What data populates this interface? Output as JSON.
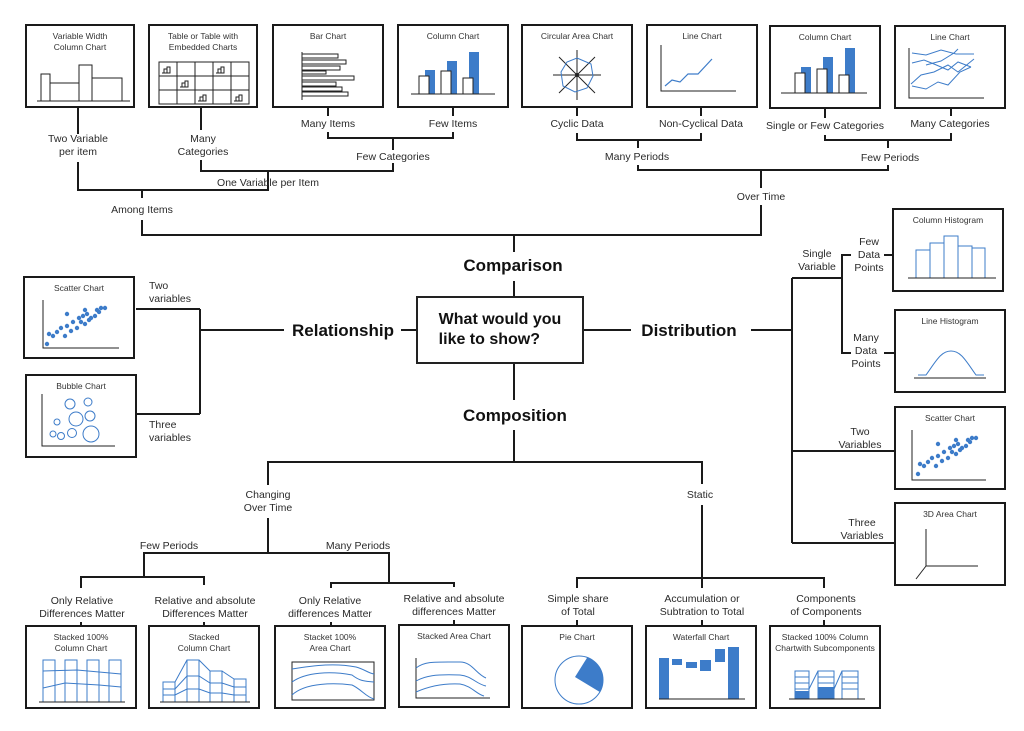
{
  "central_question": "What would you\nlike to show?",
  "categories": {
    "comparison": "Comparison",
    "relationship": "Relationship",
    "distribution": "Distribution",
    "composition": "Composition"
  },
  "accent_color": "#3d7cc9",
  "comparison": {
    "among_items": "Among Items",
    "over_time": "Over Time",
    "two_variable_per_item": "Two Variable\nper item",
    "one_variable_per_item": "One Variable per Item",
    "many_categories": "Many\nCategories",
    "few_categories": "Few Categories",
    "many_items": "Many Items",
    "few_items": "Few Items",
    "many_periods": "Many Periods",
    "few_periods": "Few Periods",
    "cyclic_data": "Cyclic Data",
    "non_cyclical_data": "Non-Cyclical Data",
    "single_or_few_categories": "Single or Few Categories",
    "many_categories_time": "Many Categories",
    "charts": {
      "variable_width": "Variable Width\nColumn Chart",
      "table_embedded": "Table or Table with\nEmbedded Charts",
      "bar_chart": "Bar Chart",
      "column_chart_items": "Column Chart",
      "circular_area": "Circular Area Chart",
      "line_chart_noncyclic": "Line Chart",
      "column_chart_time": "Column Chart",
      "line_chart_many": "Line Chart"
    }
  },
  "relationship": {
    "two_variables": "Two\nvariables",
    "three_variables": "Three\nvariables",
    "charts": {
      "scatter": "Scatter Chart",
      "bubble": "Bubble Chart"
    }
  },
  "distribution": {
    "single_variable": "Single\nVariable",
    "few_data_points": "Few\nData\nPoints",
    "many_data_points": "Many\nData\nPoints",
    "two_variables": "Two\nVariables",
    "three_variables": "Three\nVariables",
    "charts": {
      "column_histogram": "Column Histogram",
      "line_histogram": "Line Histogram",
      "scatter": "Scatter Chart",
      "area_3d": "3D Area Chart"
    }
  },
  "composition": {
    "changing_over_time": "Changing\nOver Time",
    "static": "Static",
    "few_periods": "Few Periods",
    "many_periods": "Many Periods",
    "only_relative_few": "Only Relative\nDifferences Matter",
    "relative_absolute_few": "Relative and absolute\nDifferences Matter",
    "only_relative_many": "Only Relative\ndifferences Matter",
    "relative_absolute_many": "Relative and absolute\ndifferences Matter",
    "simple_share": "Simple share\nof Total",
    "accumulation": "Accumulation or\nSubtration to Total",
    "components": "Components\nof Components",
    "charts": {
      "stacked_100_column": "Stacked 100%\nColumn Chart",
      "stacked_column": "Stacked\nColumn Chart",
      "stacked_100_area": "Stacket 100%\nArea Chart",
      "stacked_area": "Stacked Area Chart",
      "pie": "Pie Chart",
      "waterfall": "Waterfall Chart",
      "stacked_100_sub": "Stacked 100% Column\nChartwith Subcomponents"
    }
  }
}
